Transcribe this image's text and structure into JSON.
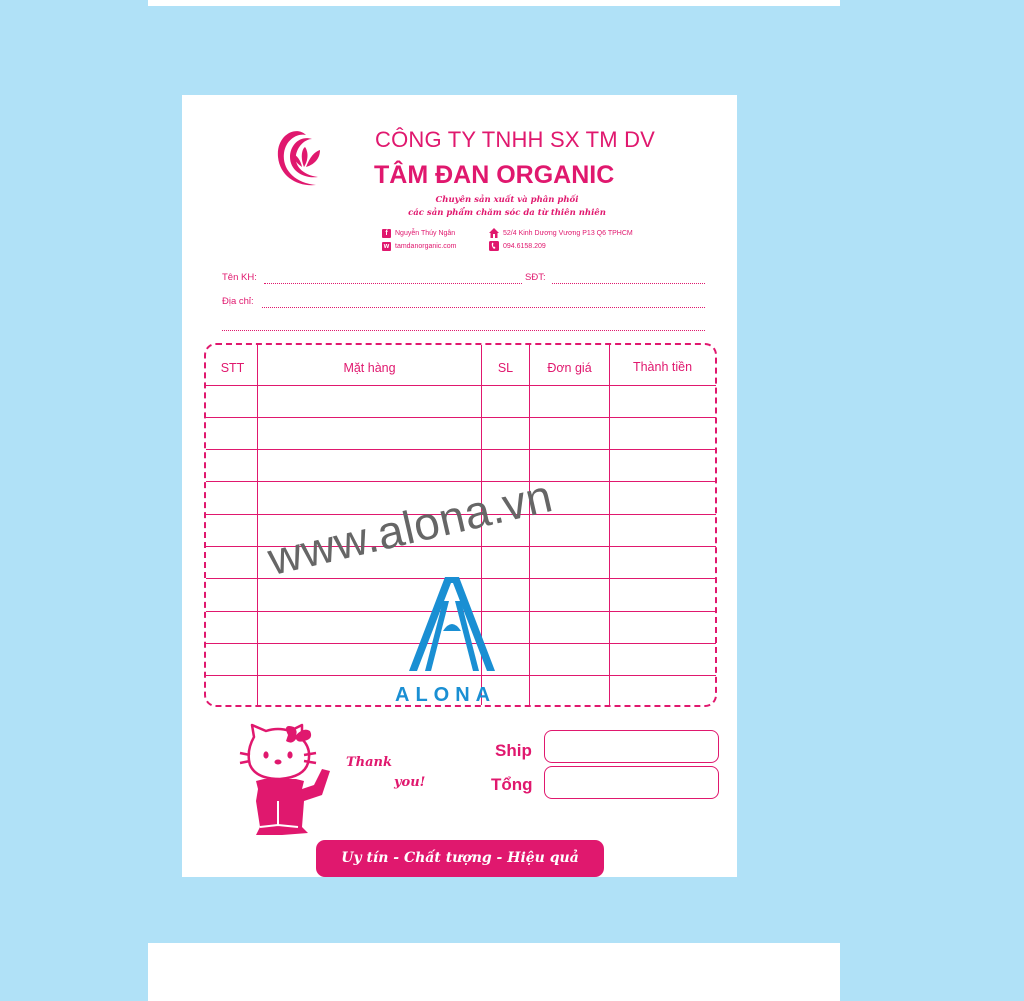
{
  "company": {
    "line1": "CÔNG TY TNHH SX TM DV",
    "name": "TÂM ĐAN ORGANIC",
    "slogan_line1": "Chuyên sản xuất và phân phối",
    "slogan_line2": "các sản phẩm chăm sóc da từ thiên nhiên"
  },
  "contact": {
    "facebook": "Nguyễn Thúy Ngân",
    "website": "tamdanorganic.com",
    "address": "52/4 Kinh Dương Vương P13 Q6 TPHCM",
    "phone": "094.6158.209",
    "facebook_glyph": "f",
    "website_glyph": "w"
  },
  "form": {
    "customer_label": "Tên KH:",
    "phone_label": "SĐT:",
    "address_label": "Địa chỉ:"
  },
  "table": {
    "headers": [
      "STT",
      "Mặt hàng",
      "SL",
      "Đơn giá",
      "Thành tiền"
    ],
    "rows": 10
  },
  "watermark": {
    "url": "www.alona.vn",
    "brand": "ALONA"
  },
  "thanks": {
    "line1": "Thank",
    "line2": "you!"
  },
  "totals": {
    "ship_label": "Ship",
    "total_label": "Tổng"
  },
  "footer": {
    "motto": "Uy tín - Chất tượng - Hiệu quả"
  },
  "colors": {
    "brand_pink": "#e0186e",
    "background_blue": "#b0e1f7",
    "alona_blue": "#1a8fd3"
  },
  "icons": [
    "lotus-logo-icon",
    "facebook-icon",
    "web-icon",
    "home-icon",
    "phone-icon",
    "alona-logo-icon",
    "hello-kitty-illustration"
  ]
}
